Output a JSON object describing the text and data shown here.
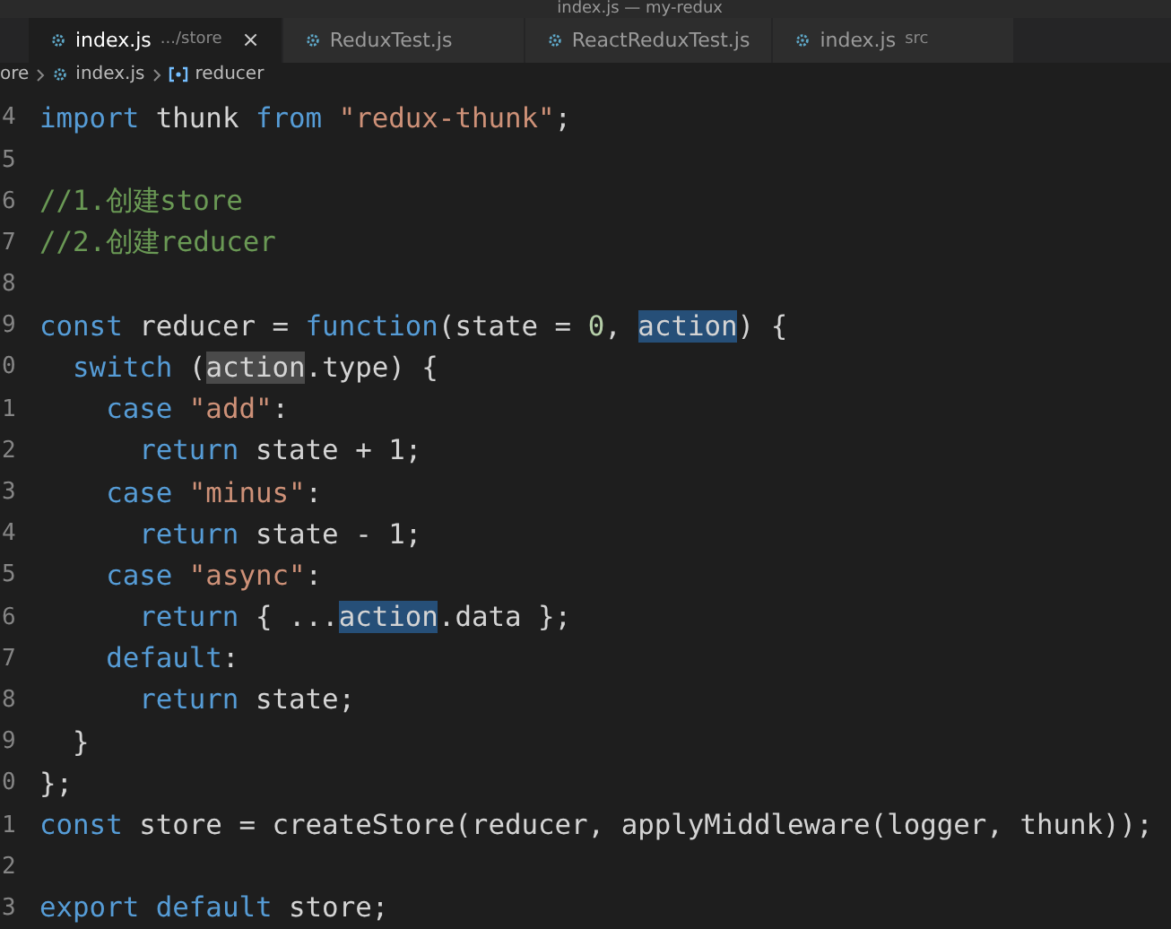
{
  "window": {
    "title": "index.js — my-redux"
  },
  "tabs": [
    {
      "label": "index.js",
      "detail": ".../store",
      "selected": true,
      "close": "×"
    },
    {
      "label": "ReduxTest.js",
      "selected": false
    },
    {
      "label": "ReactReduxTest.js",
      "selected": false
    },
    {
      "label": "index.js",
      "detail": "src",
      "selected": false
    }
  ],
  "breadcrumb": [
    "ore",
    "index.js",
    "reducer"
  ],
  "lines": [
    {
      "number": "4",
      "tokens": [
        {
          "kind": "kw",
          "text": "import"
        },
        {
          "kind": "plain",
          "text": " thunk "
        },
        {
          "kind": "kw",
          "text": "from"
        },
        {
          "kind": "str",
          "text": " \"redux-thunk\""
        },
        {
          "kind": "plain",
          "text": ";"
        }
      ]
    },
    {
      "number": "5"
    },
    {
      "number": "6",
      "tokens": [
        {
          "kind": "com",
          "text": "//1.创建store"
        }
      ]
    },
    {
      "number": "7",
      "tokens": [
        {
          "kind": "com",
          "text": "//2.创建reducer"
        }
      ]
    },
    {
      "number": "8"
    },
    {
      "number": "9",
      "tokens": [
        {
          "kind": "kw",
          "text": "const"
        },
        {
          "kind": "plain",
          "text": " reducer = "
        },
        {
          "kind": "kw",
          "text": "function"
        },
        {
          "kind": "plain",
          "text": "(state = "
        },
        {
          "kind": "num",
          "text": "0"
        },
        {
          "kind": "plain",
          "text": ","
        },
        {
          "kind": "space"
        },
        {
          "kind": "selection",
          "text": "action"
        },
        {
          "kind": "plain",
          "text": ") {"
        }
      ]
    },
    {
      "number": "0",
      "tokens": [
        {
          "kind": "kw",
          "text": "  switch"
        },
        {
          "kind": "plain",
          "text": " ("
        },
        {
          "kind": "match",
          "text": "action"
        },
        {
          "kind": "plain",
          "text": ".type) {"
        }
      ]
    },
    {
      "number": "1",
      "tokens": [
        {
          "kind": "kw",
          "text": "    case"
        },
        {
          "kind": "str",
          "text": " \"add\""
        },
        {
          "kind": "plain",
          "text": ":"
        }
      ]
    },
    {
      "number": "2",
      "tokens": [
        {
          "kind": "kw",
          "text": "      return"
        },
        {
          "kind": "plain",
          "text": " state + 1;"
        }
      ]
    },
    {
      "number": "3",
      "tokens": [
        {
          "kind": "kw",
          "text": "    case"
        },
        {
          "kind": "str",
          "text": " \"minus\""
        },
        {
          "kind": "plain",
          "text": ":"
        }
      ]
    },
    {
      "number": "4",
      "tokens": [
        {
          "kind": "kw",
          "text": "      return"
        },
        {
          "kind": "plain",
          "text": " state - 1;"
        }
      ]
    },
    {
      "number": "5",
      "tokens": [
        {
          "kind": "kw",
          "text": "    case"
        },
        {
          "kind": "str",
          "text": " \"async\""
        },
        {
          "kind": "plain",
          "text": ":"
        }
      ]
    },
    {
      "number": "6",
      "tokens": [
        {
          "kind": "kw",
          "text": "      return"
        },
        {
          "kind": "plain",
          "text": " { ..."
        },
        {
          "kind": "selection",
          "text": "action"
        },
        {
          "kind": "plain",
          "text": ".data };"
        }
      ]
    },
    {
      "number": "7",
      "tokens": [
        {
          "kind": "kw",
          "text": "    default"
        },
        {
          "kind": "plain",
          "text": ":"
        }
      ]
    },
    {
      "number": "8",
      "tokens": [
        {
          "kind": "kw",
          "text": "      return"
        },
        {
          "kind": "plain",
          "text": " state;"
        }
      ]
    },
    {
      "number": "9",
      "tokens": [
        {
          "kind": "plain",
          "text": "  }"
        }
      ]
    },
    {
      "number": "0",
      "tokens": [
        {
          "kind": "plain",
          "text": "};"
        }
      ]
    },
    {
      "number": "1",
      "tokens": [
        {
          "kind": "kw",
          "text": "const"
        },
        {
          "kind": "plain",
          "text": " store = createStore(reducer, applyMiddleware(logger, thunk));"
        }
      ]
    },
    {
      "number": "2"
    },
    {
      "number": "3",
      "tokens": [
        {
          "kind": "kw",
          "text": "export"
        },
        {
          "kind": "kw",
          "text": " default"
        },
        {
          "kind": "plain",
          "text": " store;"
        }
      ]
    }
  ]
}
